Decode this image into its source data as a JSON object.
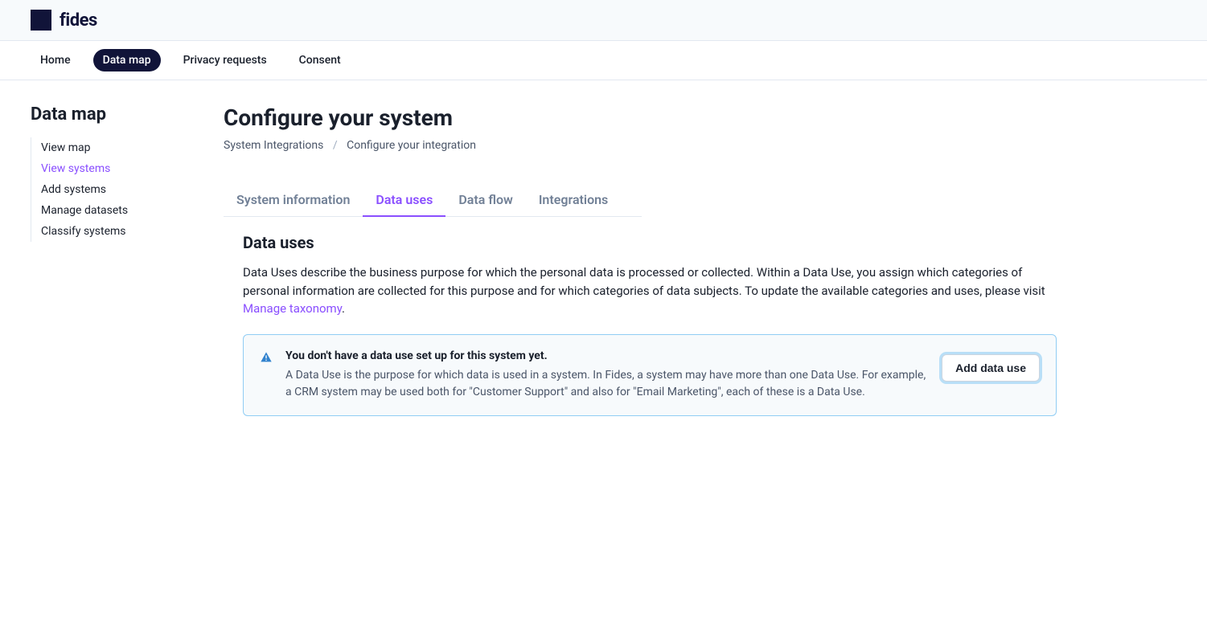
{
  "brand": "fides",
  "nav": {
    "items": [
      {
        "label": "Home"
      },
      {
        "label": "Data map"
      },
      {
        "label": "Privacy requests"
      },
      {
        "label": "Consent"
      }
    ],
    "active_index": 1
  },
  "sidebar": {
    "title": "Data map",
    "items": [
      {
        "label": "View map"
      },
      {
        "label": "View systems"
      },
      {
        "label": "Add systems"
      },
      {
        "label": "Manage datasets"
      },
      {
        "label": "Classify systems"
      }
    ],
    "active_index": 1
  },
  "main": {
    "page_title": "Configure your system",
    "breadcrumb": {
      "item1": "System Integrations",
      "sep": "/",
      "item2": "Configure your integration"
    },
    "tabs": [
      {
        "label": "System information"
      },
      {
        "label": "Data uses"
      },
      {
        "label": "Data flow"
      },
      {
        "label": "Integrations"
      }
    ],
    "tabs_active_index": 1,
    "section": {
      "title": "Data uses",
      "desc_part1": "Data Uses describe the business purpose for which the personal data is processed or collected. Within a Data Use, you assign which categories of personal information are collected for this purpose and for which categories of data subjects. To update the available categories and uses, please visit ",
      "link_text": "Manage taxonomy",
      "desc_part2": "."
    },
    "alert": {
      "title": "You don't have a data use set up for this system yet.",
      "desc": "A Data Use is the purpose for which data is used in a system. In Fides, a system may have more than one Data Use. For example, a CRM system may be used both for \"Customer Support\" and also for \"Email Marketing\", each of these is a Data Use.",
      "button": "Add data use"
    }
  }
}
